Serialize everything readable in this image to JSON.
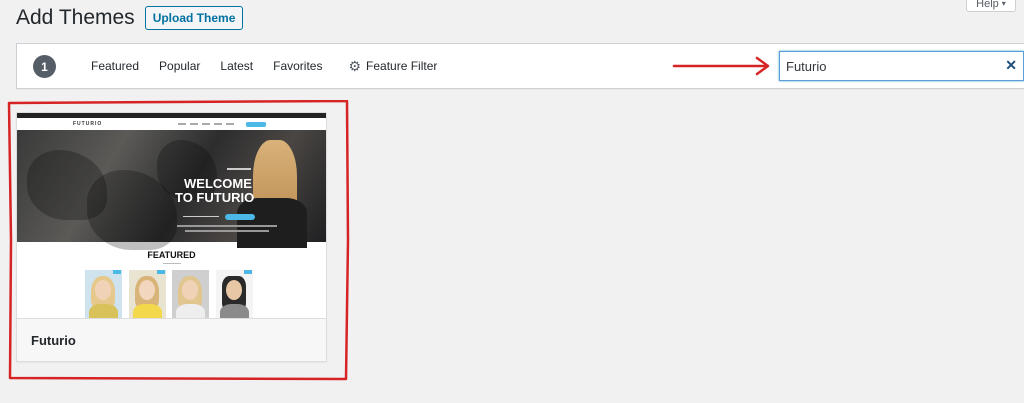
{
  "header": {
    "title": "Add Themes",
    "upload_label": "Upload Theme"
  },
  "help": {
    "label": "Help"
  },
  "filter": {
    "count": "1",
    "links": [
      "Featured",
      "Popular",
      "Latest",
      "Favorites"
    ],
    "feature_filter_label": "Feature Filter",
    "gear_icon": "gear-icon"
  },
  "search": {
    "value": "Futurio",
    "clear_icon": "close-icon"
  },
  "annotation": {
    "color": "#d62424"
  },
  "theme": {
    "name": "Futurio",
    "screenshot": {
      "logo": "FUTURIO",
      "hero_line1": "WELCOME",
      "hero_line2": "TO FUTURIO",
      "section_title": "FEATURED"
    }
  },
  "colors": {
    "accent": "#0071a1",
    "badge": "#555d66",
    "focus": "#5b9dd9",
    "preview_button": "#4cb8e8"
  }
}
